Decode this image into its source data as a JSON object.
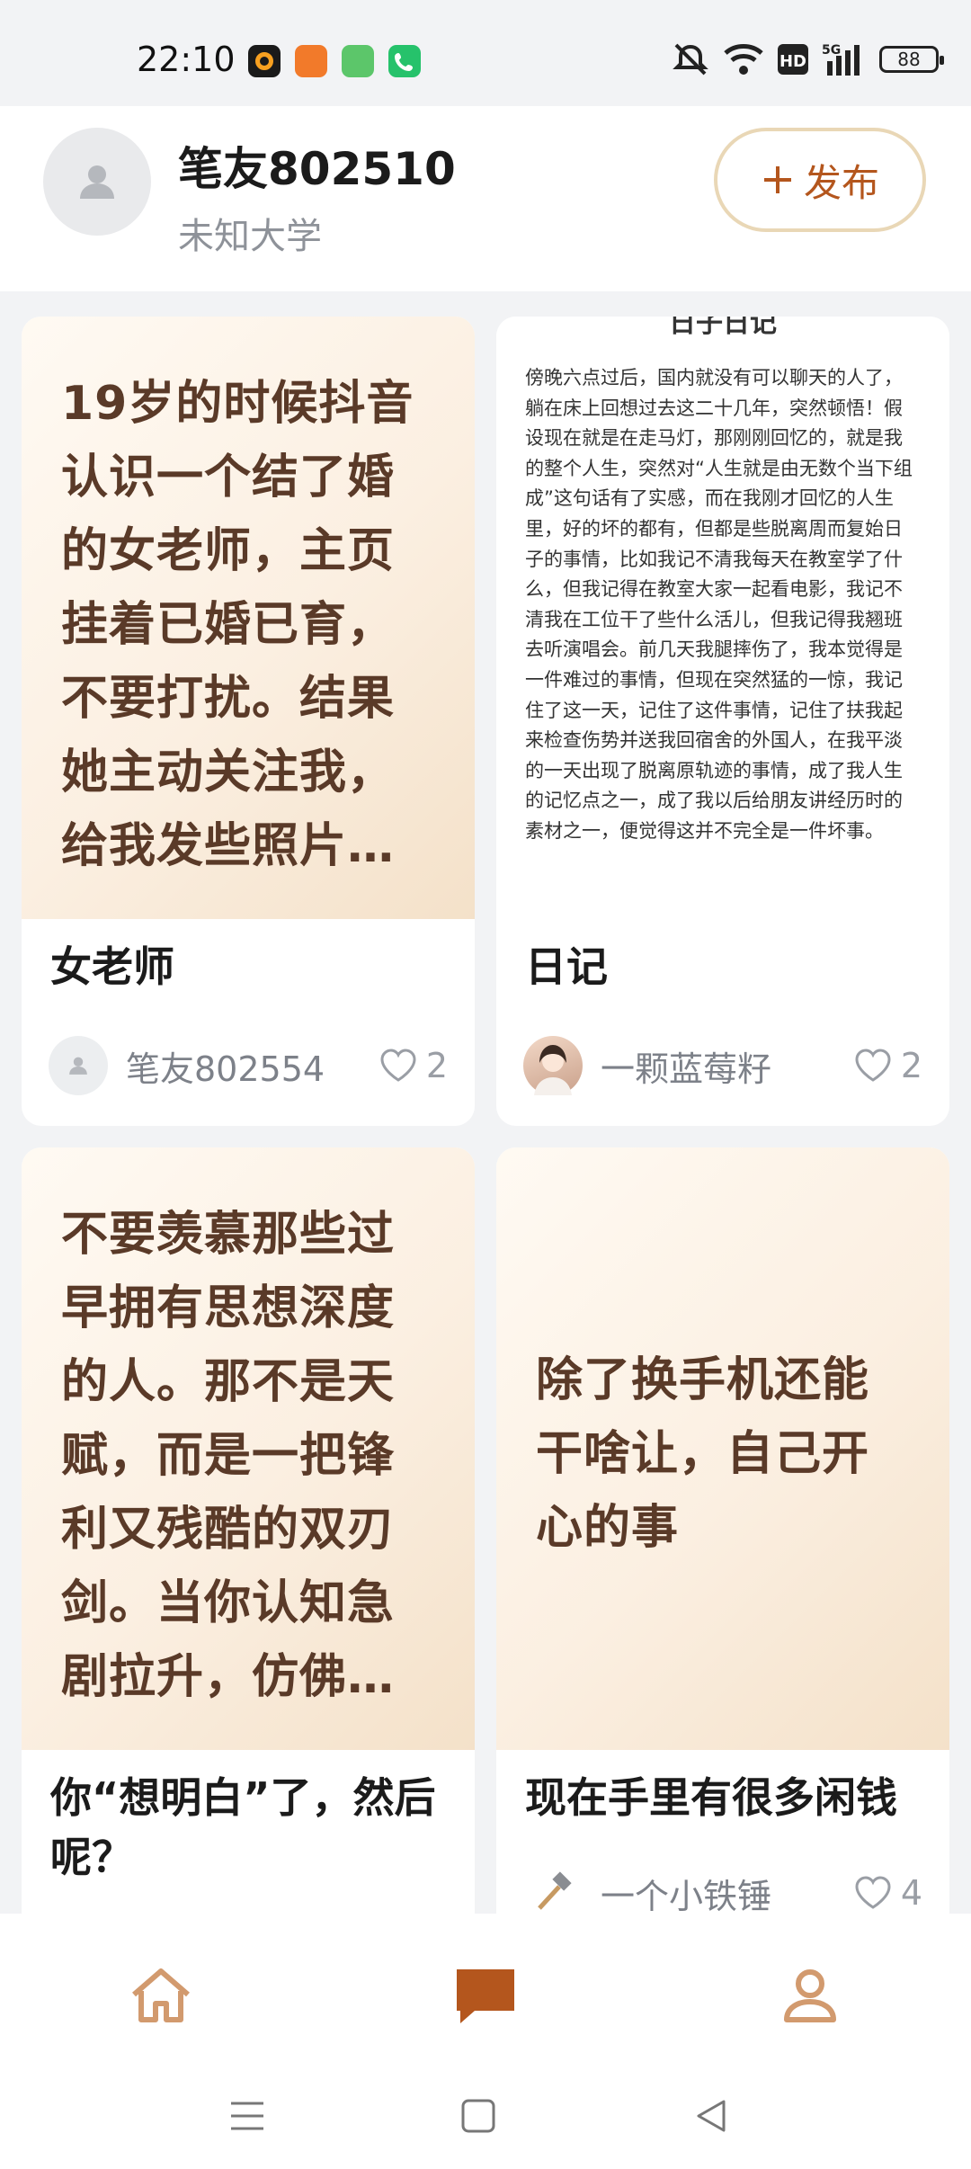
{
  "status_bar": {
    "time": "22:10",
    "battery": "88",
    "app_icon_colors": [
      "#1a1a1a",
      "#f27a2a",
      "#5cc66a",
      "#26c26b"
    ]
  },
  "header": {
    "username": "笔友802510",
    "school": "未知大学",
    "publish_label": "发布",
    "publish_icon": "plus-icon",
    "accent_color": "#b4561d"
  },
  "posts": [
    {
      "cover_text": "19岁的时候抖音认识一个结了婚的女老师，主页挂着已婚已育，不要打扰。结果她主动关注我，给我发些照片…",
      "title": "女老师",
      "author": "笔友802554",
      "likes": "2"
    },
    {
      "cover_title_partial": "日子日记",
      "cover_text": "傍晚六点过后，国内就没有可以聊天的人了，躺在床上回想过去这二十几年，突然顿悟！假设现在就是在走马灯，那刚刚回忆的，就是我的整个人生，突然对“人生就是由无数个当下组成”这句话有了实感，而在我刚才回忆的人生里，好的坏的都有，但都是些脱离周而复始日子的事情，比如我记不清我每天在教室学了什么，但我记得在教室大家一起看电影，我记不清我在工位干了些什么活儿，但我记得我翘班去听演唱会。前几天我腿摔伤了，我本觉得是一件难过的事情，但现在突然猛的一惊，我记住了这一天，记住了这件事情，记住了扶我起来检查伤势并送我回宿舍的外国人，在我平淡的一天出现了脱离原轨迹的事情，成了我人生的记忆点之一，成了我以后给朋友讲经历时的素材之一，便觉得这并不完全是一件坏事。",
      "title": "日记",
      "author": "一颗蓝莓籽",
      "likes": "2"
    },
    {
      "cover_text": "不要羡慕那些过早拥有思想深度的人。那不是天赋，而是一把锋利又残酷的双刃剑。当你认知急剧拉升，仿佛…",
      "title": "你“想明白”了，然后呢？",
      "author": "",
      "likes": ""
    },
    {
      "cover_text": "除了换手机还能干啥让，自己开心的事",
      "title": "现在手里有很多闲钱",
      "author": "一个小铁锤",
      "likes": "4"
    }
  ],
  "bottom_nav": {
    "items": [
      "home-icon",
      "message-icon",
      "profile-icon"
    ],
    "active": "message-icon"
  },
  "system_nav": [
    "menu-icon",
    "square-icon",
    "back-icon"
  ]
}
